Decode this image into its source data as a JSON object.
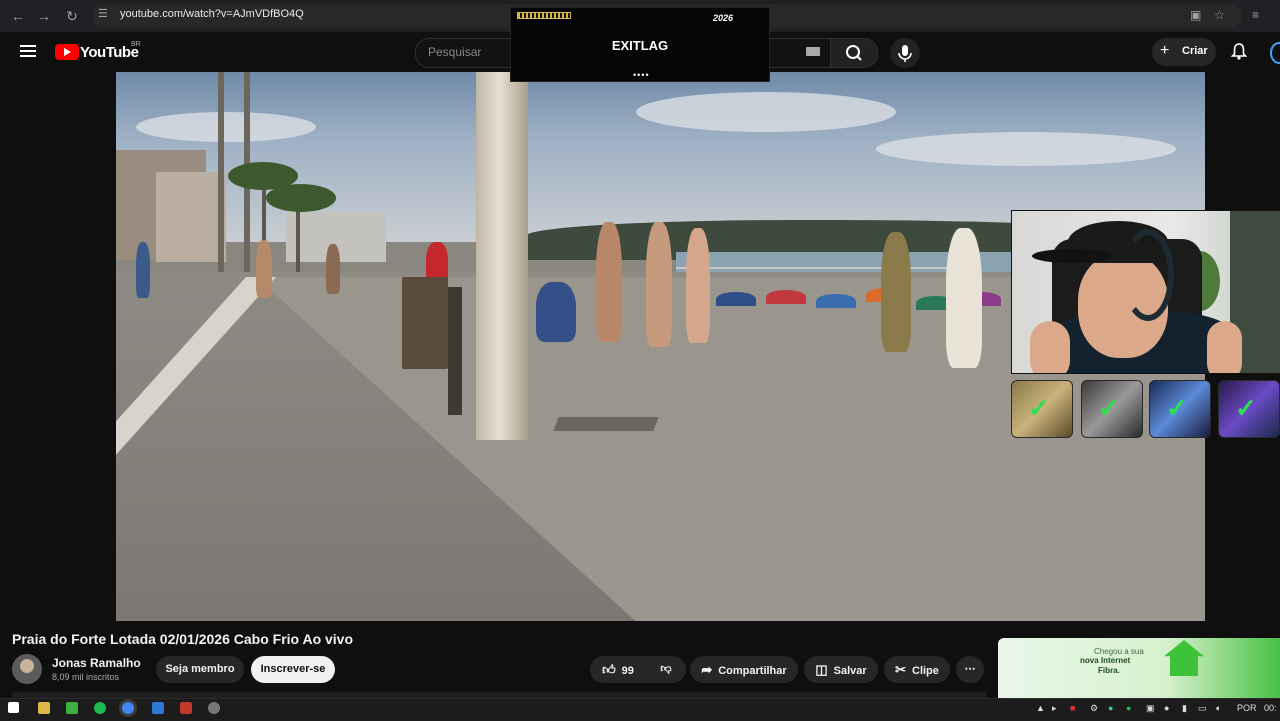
{
  "browser": {
    "url": "youtube.com/watch?v=AJmVDfBO4Q"
  },
  "youtube": {
    "logo_text": "YouTube",
    "country_code": "BR",
    "search_placeholder": "Pesquisar",
    "create_label": "Criar"
  },
  "overlay_ad_top": {
    "brand": "EXITLAG",
    "badge": "2026"
  },
  "video": {
    "title": "Praia do Forte Lotada 02/01/2026 Cabo Frio Ao vivo"
  },
  "channel": {
    "name": "Jonas Ramalho",
    "subscribers": "8,09 mil inscritos",
    "member_label": "Seja membro",
    "subscribe_label": "Inscrever-se"
  },
  "actions": {
    "like_count": "99",
    "share_label": "Compartilhar",
    "save_label": "Salvar",
    "clip_label": "Clipe",
    "more_label": "⋯"
  },
  "side_ad": {
    "line1": "Chegou a sua",
    "line2": "nova Internet",
    "line3": "Fibra."
  },
  "taskbar": {
    "language": "POR",
    "time": "00:"
  },
  "colors": {
    "youtube_red": "#ff0000",
    "background": "#0f0f0f",
    "check_green": "#2ee04d",
    "accent_blue": "#3ea6ff"
  },
  "icons": [
    "back-icon",
    "forward-icon",
    "reload-icon",
    "site-info-icon",
    "install-icon",
    "bookmark-star-icon",
    "menu-icon",
    "search-icon",
    "mic-icon",
    "plus-icon",
    "bell-icon",
    "like-icon",
    "dislike-icon",
    "share-icon",
    "save-icon",
    "clip-icon",
    "more-icon",
    "windows-start-icon",
    "check-icon"
  ]
}
